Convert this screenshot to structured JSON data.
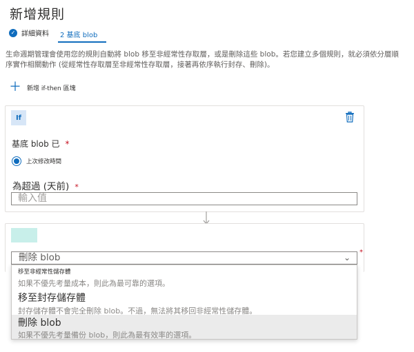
{
  "page": {
    "title": "新增規則"
  },
  "tabs": [
    {
      "label": "詳細資料",
      "completed": true
    },
    {
      "label": "2 基底 blob",
      "active": true
    }
  ],
  "description": "生命週期管理會使用您的規則自動將 blob 移至非經常性存取層，或是刪除這些 blob。若您建立多個規則，就必須依分層順序實作相關動作 (從經常性存取層至非經常性存取層，接著再依序執行封存、刪除)。",
  "add_block": {
    "label": "新增 if-then 區塊"
  },
  "if_block": {
    "badge": "If",
    "base_blob_label": "基底 blob 已",
    "required_mark": "*",
    "radio_option": "上次修改時間",
    "days_label": "為超過 (天前)",
    "days_placeholder": "輸入值"
  },
  "then_block": {
    "select_value": "刪除 blob",
    "required_mark": "*",
    "dropdown_header": "移至非經常性儲存體",
    "options": [
      {
        "title": "",
        "subtitle": "如果不優先考量成本，則此為最可靠的選項。"
      },
      {
        "title": "移至封存儲存體",
        "subtitle": "封存儲存體不會完全刪除 blob。不過，無法將其移回非經常性儲存體。"
      },
      {
        "title": "刪除 blob",
        "subtitle": "如果不優先考量備份 blob，則此為最有效率的選項。",
        "selected": true
      }
    ]
  },
  "colors": {
    "accent": "#0f6cbd",
    "required": "#c50f1f",
    "then_badge": "#c8efea",
    "if_badge": "#d7e6f7"
  }
}
